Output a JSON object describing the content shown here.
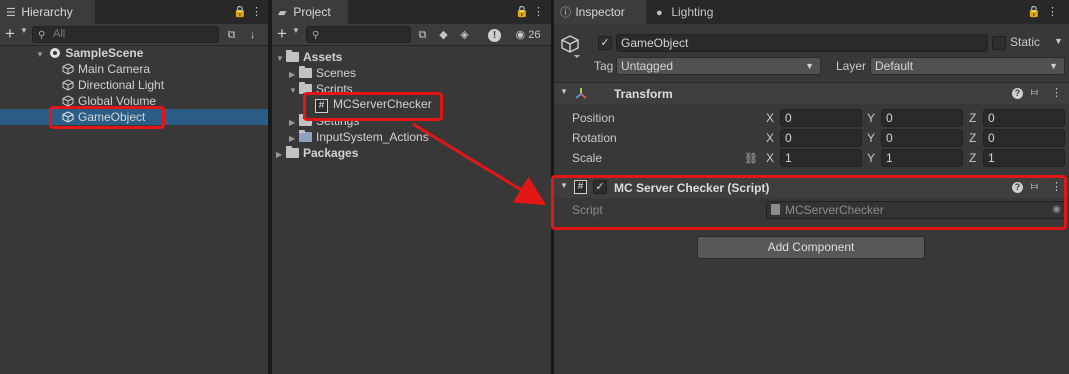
{
  "hierarchy": {
    "tab_label": "Hierarchy",
    "search_placeholder": "All",
    "scene_name": "SampleScene",
    "items": [
      {
        "label": "Main Camera"
      },
      {
        "label": "Directional Light"
      },
      {
        "label": "Global Volume"
      },
      {
        "label": "GameObject"
      }
    ]
  },
  "project": {
    "tab_label": "Project",
    "item_count": "26",
    "tree": {
      "assets": "Assets",
      "scenes": "Scenes",
      "scripts": "Scripts",
      "script_file": "MCServerChecker",
      "settings": "Settings",
      "input_actions": "InputSystem_Actions",
      "packages": "Packages"
    }
  },
  "inspector": {
    "tab_label": "Inspector",
    "lighting_tab_label": "Lighting",
    "object_name": "GameObject",
    "static_label": "Static",
    "tag_label": "Tag",
    "tag_value": "Untagged",
    "layer_label": "Layer",
    "layer_value": "Default",
    "transform": {
      "title": "Transform",
      "rows": [
        {
          "label": "Position",
          "x": "0",
          "y": "0",
          "z": "0"
        },
        {
          "label": "Rotation",
          "x": "0",
          "y": "0",
          "z": "0"
        },
        {
          "label": "Scale",
          "x": "1",
          "y": "1",
          "z": "1"
        }
      ],
      "axis_x": "X",
      "axis_y": "Y",
      "axis_z": "Z"
    },
    "script_component": {
      "title": "MC Server Checker (Script)",
      "script_label": "Script",
      "script_value": "MCServerChecker"
    },
    "add_component_label": "Add Component"
  },
  "colors": {
    "selection": "#2c5d87",
    "highlight": "#e31616",
    "panel": "#383838"
  }
}
